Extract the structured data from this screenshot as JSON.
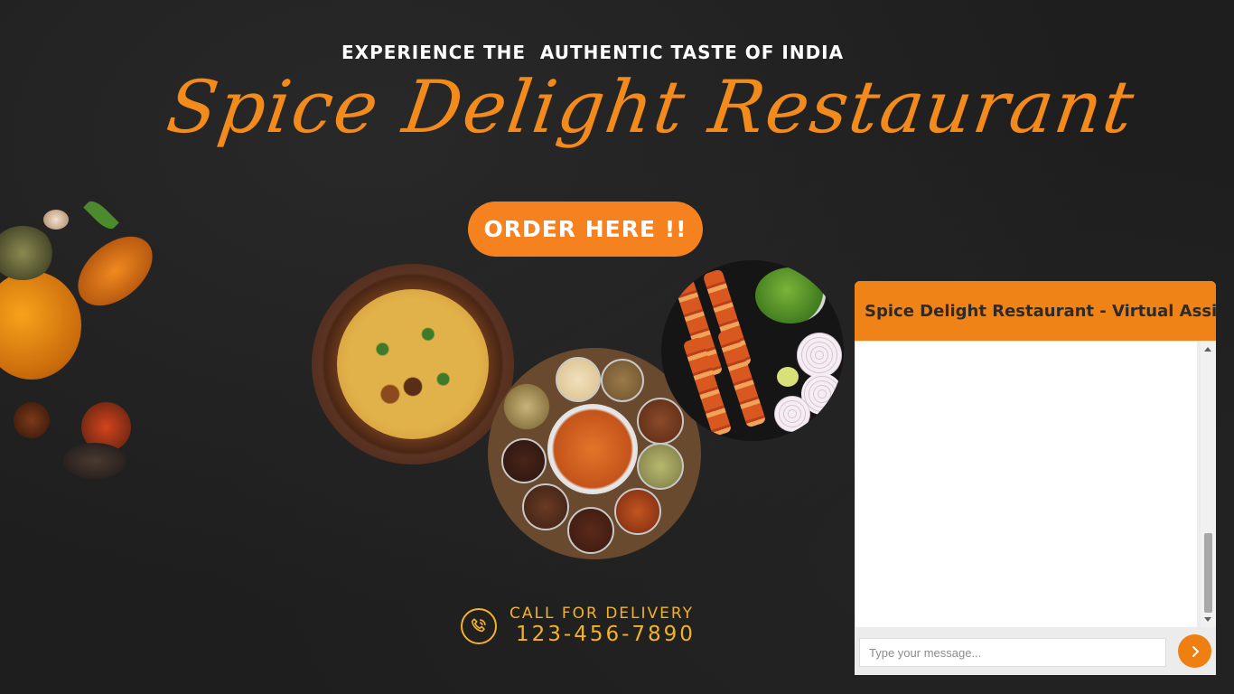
{
  "hero": {
    "tagline": "EXPERIENCE THE  AUTHENTIC TASTE OF INDIA",
    "brand": "Spice Delight Restaurant",
    "order_button": "ORDER HERE !!"
  },
  "images": {
    "plate_1": "biryani-bowl",
    "plate_2": "spice-thali",
    "plate_3": "paneer-tikka-skewers"
  },
  "delivery": {
    "label": "CALL FOR DELIVERY",
    "phone": "123-456-7890",
    "icon": "phone-icon"
  },
  "chat": {
    "title": "Spice Delight Restaurant - Virtual Assistant",
    "input_placeholder": "Type your message...",
    "send_icon": "chevron-right-icon"
  },
  "colors": {
    "accent": "#f6821f",
    "gold": "#f4b225",
    "background": "#1e1e1e"
  }
}
